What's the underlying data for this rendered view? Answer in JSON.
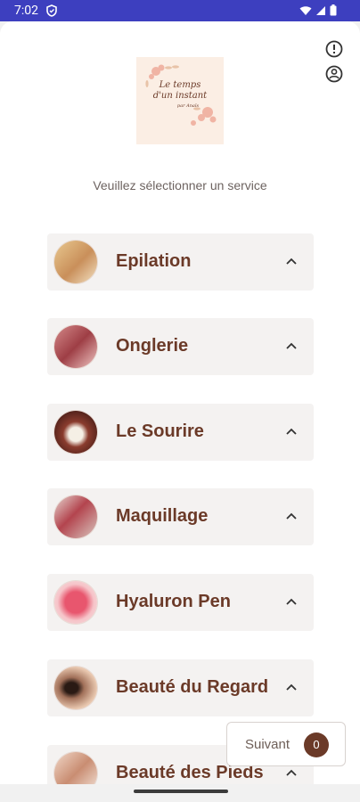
{
  "status_bar": {
    "time": "7:02"
  },
  "header": {
    "logo_text_line1": "Le temps",
    "logo_text_line2": "d'un instant",
    "logo_text_line3": "par Anaïs"
  },
  "prompt": "Veuillez sélectionner un service",
  "services": [
    {
      "label": "Epilation"
    },
    {
      "label": "Onglerie"
    },
    {
      "label": "Le Sourire"
    },
    {
      "label": "Maquillage"
    },
    {
      "label": "Hyaluron Pen"
    },
    {
      "label": "Beauté du Regard"
    },
    {
      "label": "Beauté des Pieds"
    }
  ],
  "footer": {
    "next_label": "Suivant",
    "selected_count": "0"
  },
  "colors": {
    "accent": "#6b3a28",
    "status_bar": "#3d3fbf",
    "card_bg": "#f4f2f1"
  }
}
